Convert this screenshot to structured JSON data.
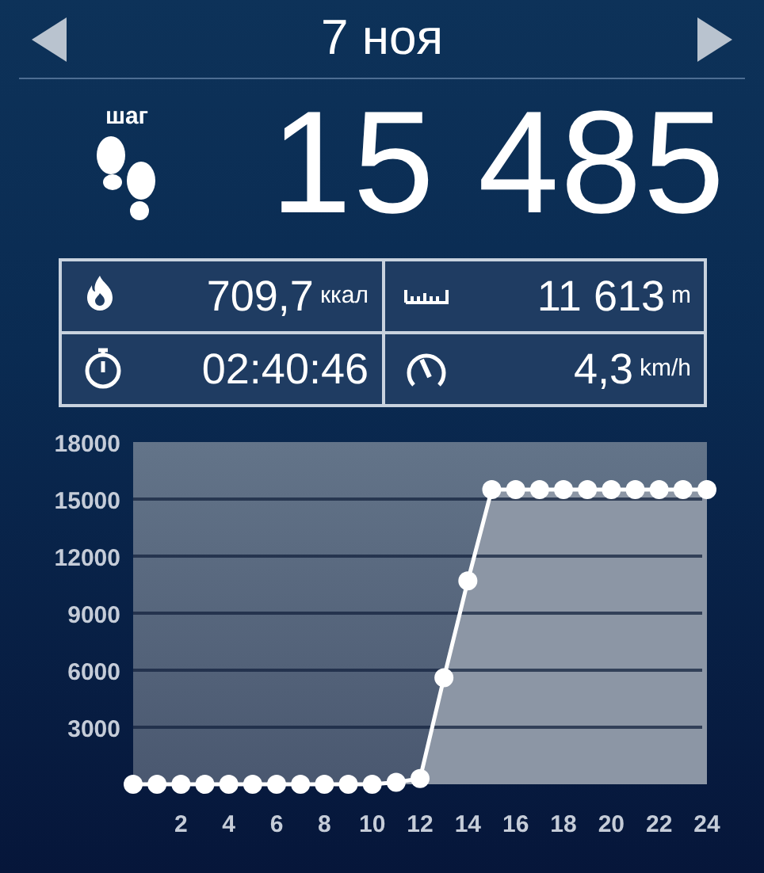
{
  "date": "7 ноя",
  "steps": {
    "label": "шаг",
    "value": "15 485"
  },
  "stats": [
    {
      "kind": "calories",
      "value": "709,7",
      "unit": "ккал"
    },
    {
      "kind": "distance",
      "value": "11 613",
      "unit": "m"
    },
    {
      "kind": "duration",
      "value": "02:40:46"
    },
    {
      "kind": "speed",
      "value": "4,3",
      "unit": "km/h"
    }
  ],
  "chart": {
    "chart_data": {
      "type": "area",
      "x": [
        0,
        1,
        2,
        3,
        4,
        5,
        6,
        7,
        8,
        9,
        10,
        11,
        12,
        13,
        14,
        15,
        16,
        17,
        18,
        19,
        20,
        21,
        22,
        23,
        24
      ],
      "series": [
        {
          "color": "#ffffff",
          "values": [
            0,
            0,
            0,
            0,
            0,
            0,
            0,
            0,
            0,
            0,
            0,
            100,
            300,
            5600,
            10700,
            15500,
            15500,
            15500,
            15500,
            15500,
            15500,
            15500,
            15500,
            15500,
            15500
          ]
        }
      ],
      "grid": true,
      "xlim": [
        0,
        24
      ],
      "ylim": [
        0,
        18000
      ],
      "xticks": [
        2,
        4,
        6,
        8,
        10,
        12,
        14,
        16,
        18,
        20,
        22,
        24
      ],
      "yticks": [
        3000,
        6000,
        9000,
        12000,
        15000,
        18000
      ]
    }
  }
}
